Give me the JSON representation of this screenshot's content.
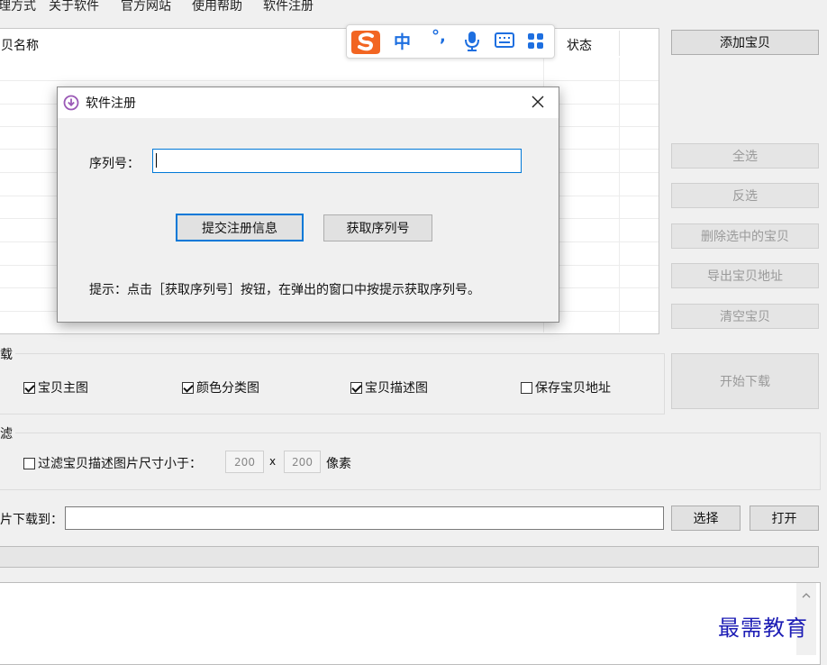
{
  "menu": {
    "items": [
      "理方式",
      "关于软件",
      "官方网站",
      "使用帮助",
      "软件注册"
    ]
  },
  "list": {
    "col_name": "贝名称",
    "col_status": "状态"
  },
  "side_buttons": {
    "add": "添加宝贝",
    "select_all": "全选",
    "invert": "反选",
    "delete_selected": "删除选中的宝贝",
    "export_urls": "导出宝贝地址",
    "clear": "清空宝贝"
  },
  "download_group": {
    "label": "载",
    "main_image": "宝贝主图",
    "color_image": "颜色分类图",
    "desc_image": "宝贝描述图",
    "save_url": "保存宝贝地址",
    "start_button": "开始下载"
  },
  "filter_group": {
    "label": "滤",
    "filter_text": "过滤宝贝描述图片尺寸小于：",
    "width": "200",
    "times": "x",
    "height": "200",
    "unit": "像素"
  },
  "save_path": {
    "label": "片下载到：",
    "value": "",
    "choose": "选择",
    "open": "打开"
  },
  "ime_toolbar": {
    "lang": "中",
    "punct": "°,"
  },
  "dialog": {
    "title": "软件注册",
    "serial_label": "序列号：",
    "serial_value": "",
    "submit": "提交注册信息",
    "get_serial": "获取序列号",
    "hint": "提示：点击［获取序列号］按钮，在弹出的窗口中按提示获取序列号。"
  },
  "watermark": "最需教育",
  "colors": {
    "accent": "#0078d7",
    "ime_orange": "#f26522",
    "ime_blue": "#1e6fe0",
    "dialog_icon": "#9b59b6"
  }
}
